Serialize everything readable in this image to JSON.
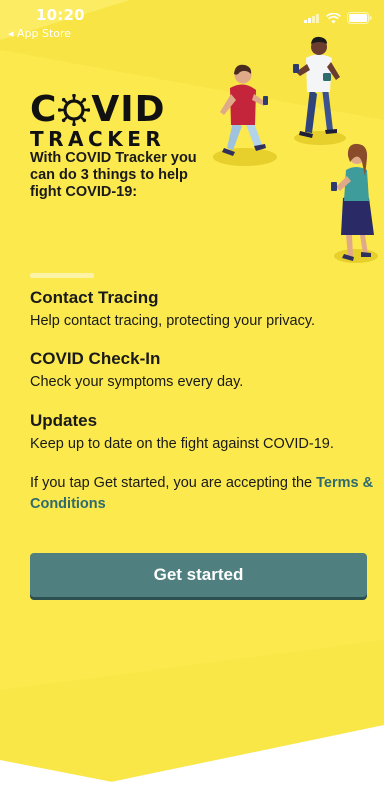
{
  "status_bar": {
    "time": "10:20",
    "back_label": "◂ App Store"
  },
  "logo": {
    "covid_prefix": "C",
    "covid_suffix": "VID",
    "tracker": "TRACKER"
  },
  "intro_text": "With COVID Tracker you can do 3 things to help fight COVID-19:",
  "features": [
    {
      "title": "Contact Tracing",
      "description": "Help contact tracing, protecting your privacy."
    },
    {
      "title": "COVID Check-In",
      "description": "Check your symptoms every day."
    },
    {
      "title": "Updates",
      "description": "Keep up to date on the fight against COVID-19."
    }
  ],
  "terms": {
    "prefix": "If you tap Get started, you are accepting the ",
    "link": "Terms & Conditions"
  },
  "get_started_label": "Get started",
  "colors": {
    "background_yellow": "#f9e64a",
    "button": "#4f7f7e",
    "link": "#2f6a6e"
  }
}
